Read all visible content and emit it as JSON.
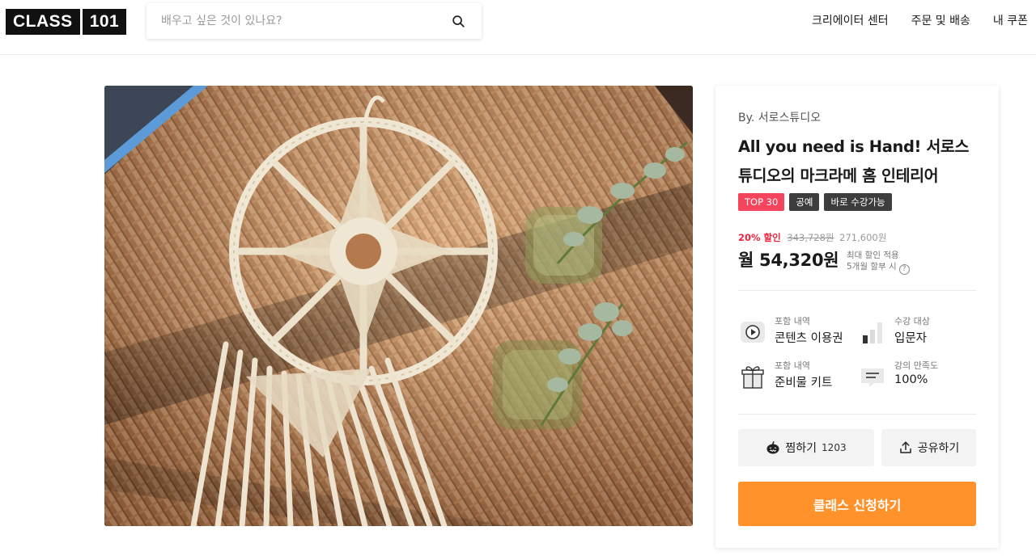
{
  "header": {
    "logo_left": "CLASS",
    "logo_right": "101",
    "search_placeholder": "배우고 싶은 것이 있나요?",
    "nav": [
      "크리에이터 센터",
      "주문 및 배송",
      "내 쿠폰"
    ]
  },
  "product": {
    "creator": "By. 서로스튜디오",
    "title": "All you need is Hand! 서로스튜디오의 마크라메 홈 인테리어",
    "badges": [
      "TOP 30",
      "공예",
      "바로 수강가능"
    ],
    "discount": "20% 할인",
    "original_price": "343,728원",
    "sale_price": "271,600원",
    "monthly": "월 54,320원",
    "install_line1": "최대 할인 적용",
    "install_line2": "5개월 할부 시",
    "info": [
      {
        "label": "포함 내역",
        "value": "콘텐츠 이용권",
        "icon": "play-icon"
      },
      {
        "label": "수강 대상",
        "value": "입문자",
        "icon": "level-bars-icon"
      },
      {
        "label": "포함 내역",
        "value": "준비물 키트",
        "icon": "gift-icon"
      },
      {
        "label": "강의 만족도",
        "value": "100%",
        "icon": "comment-icon"
      }
    ],
    "wish_label": "찜하기",
    "wish_count": "1203",
    "share_label": "공유하기",
    "cta_label": "클래스 신청하기"
  },
  "colors": {
    "cta": "#ff922b",
    "hot_badge": "#f5445e",
    "discount": "#f5223e",
    "badge_dark": "#3d3d3d"
  }
}
